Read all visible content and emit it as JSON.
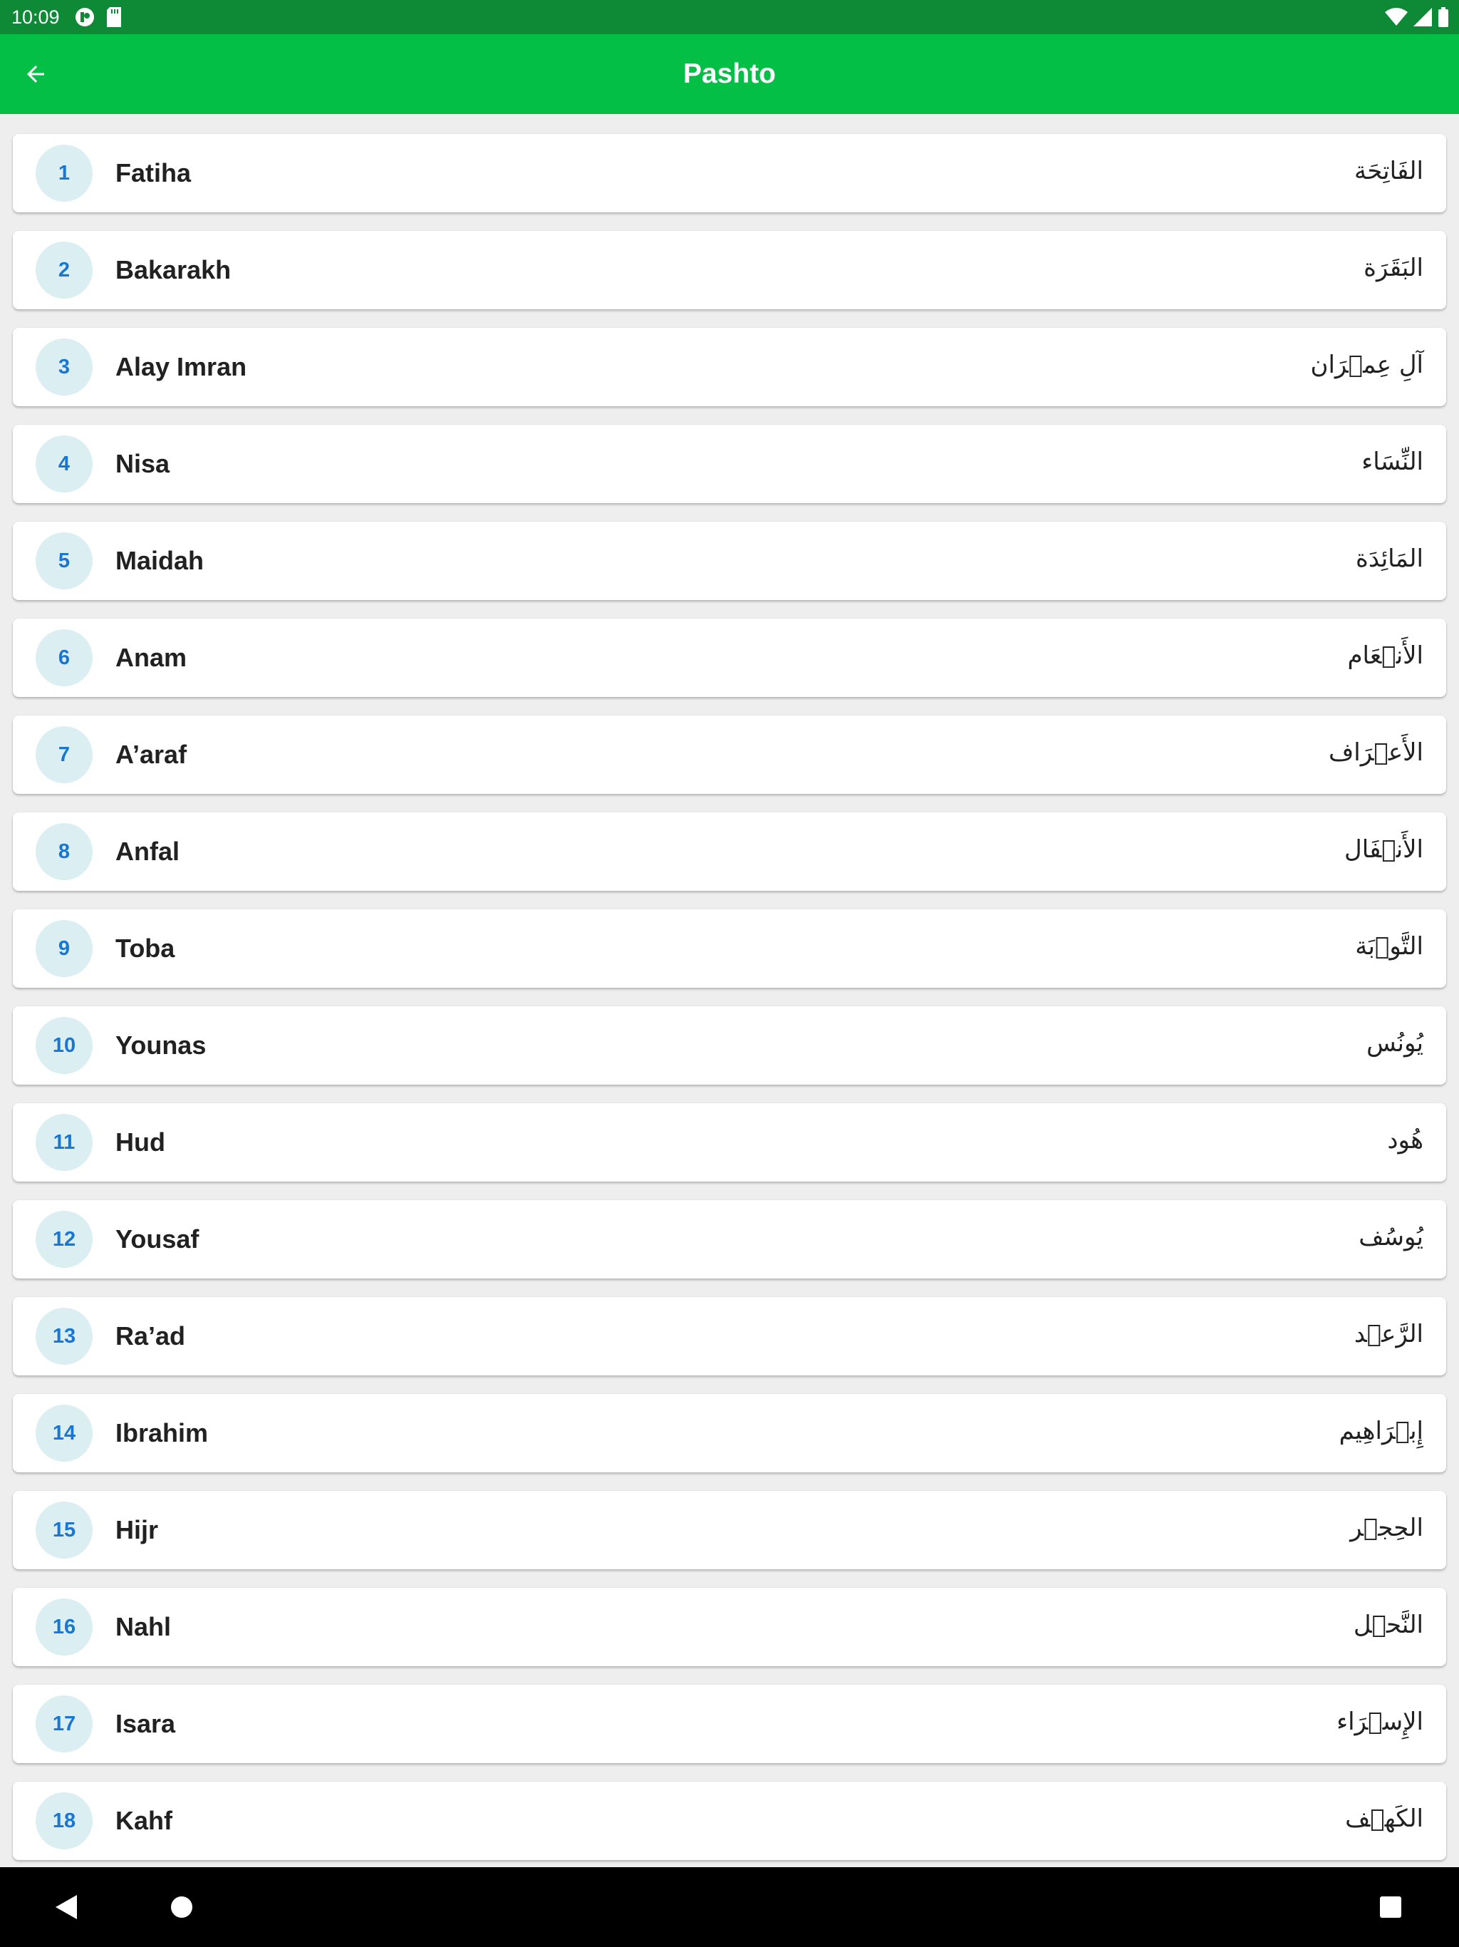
{
  "status_bar": {
    "time": "10:09"
  },
  "app_bar": {
    "title": "Pashto"
  },
  "surahs": [
    {
      "number": "1",
      "name": "Fatiha",
      "arabic": "الفَاتِحَة"
    },
    {
      "number": "2",
      "name": "Bakarakh",
      "arabic": "البَقَرَة"
    },
    {
      "number": "3",
      "name": "Alay Imran",
      "arabic": "آلِ عِمۡرَان"
    },
    {
      "number": "4",
      "name": "Nisa",
      "arabic": "النِّسَاء"
    },
    {
      "number": "5",
      "name": "Maidah",
      "arabic": "المَائِدَة"
    },
    {
      "number": "6",
      "name": "Anam",
      "arabic": "الأَنۡعَام"
    },
    {
      "number": "7",
      "name": "A’araf",
      "arabic": "الأَعۡرَاف"
    },
    {
      "number": "8",
      "name": "Anfal",
      "arabic": "الأَنۡفَال"
    },
    {
      "number": "9",
      "name": "Toba",
      "arabic": "التَّوۡبَة"
    },
    {
      "number": "10",
      "name": "Younas",
      "arabic": "يُونُس"
    },
    {
      "number": "11",
      "name": "Hud",
      "arabic": "هُود"
    },
    {
      "number": "12",
      "name": "Yousaf",
      "arabic": "يُوسُف"
    },
    {
      "number": "13",
      "name": "Ra’ad",
      "arabic": "الرَّعۡد"
    },
    {
      "number": "14",
      "name": "Ibrahim",
      "arabic": "إِبۡرَاهِيم"
    },
    {
      "number": "15",
      "name": "Hijr",
      "arabic": "الحِجۡر"
    },
    {
      "number": "16",
      "name": "Nahl",
      "arabic": "النَّحۡل"
    },
    {
      "number": "17",
      "name": "Isara",
      "arabic": "الإِسۡرَاء"
    },
    {
      "number": "18",
      "name": "Kahf",
      "arabic": "الكَهۡف"
    }
  ],
  "colors": {
    "status_bar": "#0e8a36",
    "app_bar": "#04bf45",
    "badge_bg": "#dbeef1",
    "badge_text": "#1976d2"
  },
  "icons": {
    "back": "arrow-left-icon",
    "nav_back": "triangle-back-icon",
    "nav_home": "circle-home-icon",
    "nav_recents": "square-recents-icon"
  }
}
